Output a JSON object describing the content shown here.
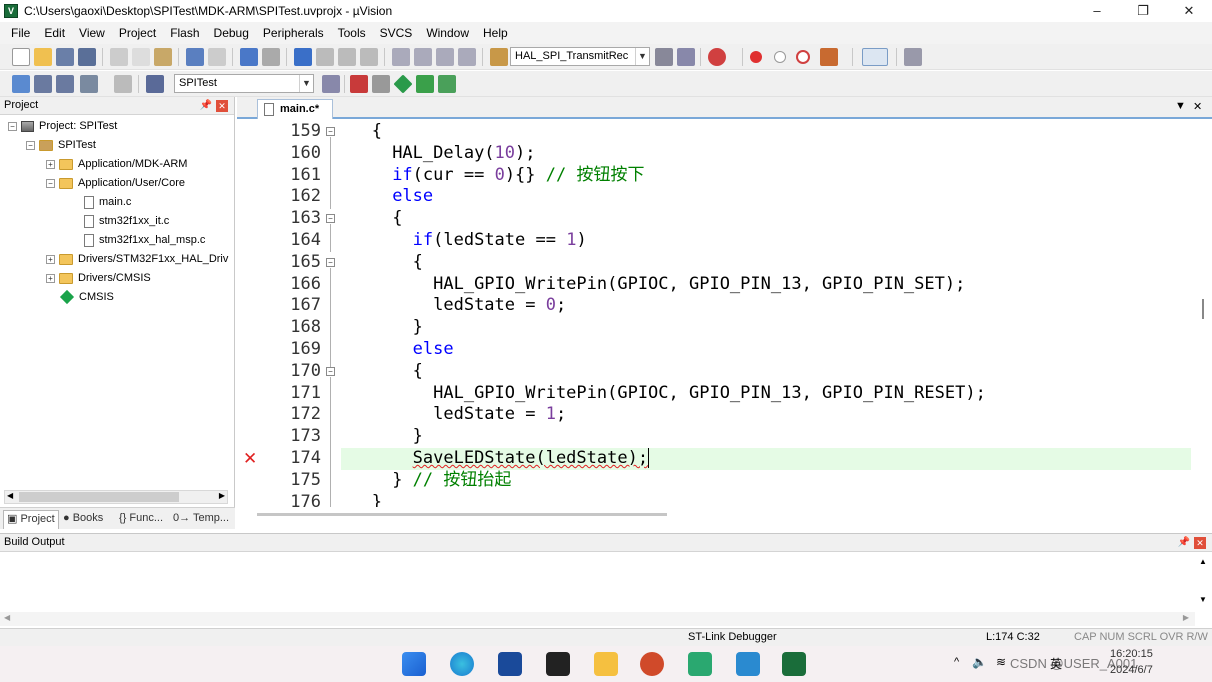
{
  "window": {
    "title": "C:\\Users\\gaoxi\\Desktop\\SPITest\\MDK-ARM\\SPITest.uvprojx - µVision",
    "controls": [
      "–",
      "❐",
      "✕"
    ]
  },
  "menu": [
    {
      "label": "File"
    },
    {
      "label": "Edit"
    },
    {
      "label": "View"
    },
    {
      "label": "Project"
    },
    {
      "label": "Flash"
    },
    {
      "label": "Debug"
    },
    {
      "label": "Peripherals"
    },
    {
      "label": "Tools"
    },
    {
      "label": "SVCS"
    },
    {
      "label": "Window"
    },
    {
      "label": "Help"
    }
  ],
  "toolbar1": {
    "find_combo": "HAL_SPI_TransmitRec"
  },
  "toolbar2": {
    "target_combo": "SPITest"
  },
  "project_panel": {
    "title": "Project",
    "tree": [
      {
        "label": "Project: SPITest"
      },
      {
        "label": "SPITest"
      },
      {
        "label": "Application/MDK-ARM"
      },
      {
        "label": "Application/User/Core"
      },
      {
        "label": "main.c"
      },
      {
        "label": "stm32f1xx_it.c"
      },
      {
        "label": "stm32f1xx_hal_msp.c"
      },
      {
        "label": "Drivers/STM32F1xx_HAL_Driv"
      },
      {
        "label": "Drivers/CMSIS"
      },
      {
        "label": "CMSIS"
      }
    ],
    "tabs": [
      {
        "label": "Project"
      },
      {
        "label": "Books"
      },
      {
        "label": "{} Func..."
      },
      {
        "label": "0→ Temp..."
      }
    ]
  },
  "editor": {
    "tab_label": "main.c*",
    "lines": [
      {
        "n": "159"
      },
      {
        "n": "160"
      },
      {
        "n": "161"
      },
      {
        "n": "162"
      },
      {
        "n": "163"
      },
      {
        "n": "164"
      },
      {
        "n": "165"
      },
      {
        "n": "166"
      },
      {
        "n": "167"
      },
      {
        "n": "168"
      },
      {
        "n": "169"
      },
      {
        "n": "170"
      },
      {
        "n": "171"
      },
      {
        "n": "172"
      },
      {
        "n": "173"
      },
      {
        "n": "174"
      },
      {
        "n": "175"
      },
      {
        "n": "176"
      }
    ],
    "code": {
      "l159": "{",
      "l160a": "HAL_Delay(",
      "l160b": "10",
      "l160c": ");",
      "l161a": "if",
      "l161b": "(cur == ",
      "l161c": "0",
      "l161d": "){} ",
      "l161e": "// 按钮按下",
      "l162": "else",
      "l163": "{",
      "l164a": "if",
      "l164b": "(ledState == ",
      "l164c": "1",
      "l164d": ")",
      "l165": "{",
      "l166": "HAL_GPIO_WritePin(GPIOC, GPIO_PIN_13, GPIO_PIN_SET);",
      "l167a": "ledState = ",
      "l167b": "0",
      "l167c": ";",
      "l168": "}",
      "l169": "else",
      "l170": "{",
      "l171": "HAL_GPIO_WritePin(GPIOC, GPIO_PIN_13, GPIO_PIN_RESET);",
      "l172a": "ledState = ",
      "l172b": "1",
      "l172c": ";",
      "l173": "}",
      "l174": "SaveLEDState(ledState);",
      "l175a": "} ",
      "l175b": "// 按钮抬起",
      "l176": "}"
    },
    "error_marker": "✕"
  },
  "build_output": {
    "title": "Build Output"
  },
  "status": {
    "debugger": "ST-Link Debugger",
    "position": "L:174 C:32",
    "flags": "CAP  NUM  SCRL  OVR  R/W"
  },
  "taskbar": {
    "time": "16:20:15",
    "date": "2024/6/7",
    "ime": "英",
    "watermark": "CSDN @USER_A001"
  },
  "colors": {
    "keyword": "#0000ff",
    "number": "#7a3e9d",
    "comment": "#008000",
    "current_line": "#e5fbe5",
    "error": "#e02020"
  }
}
